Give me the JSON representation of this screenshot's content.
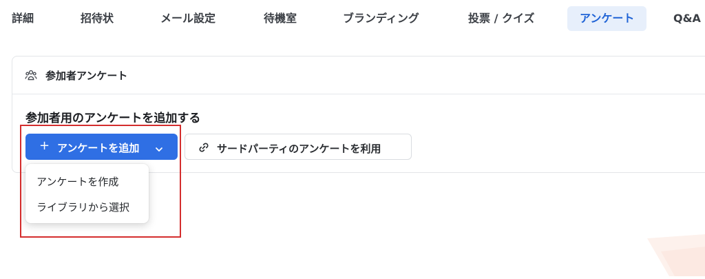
{
  "tabs": [
    {
      "label": "詳細"
    },
    {
      "label": "招待状"
    },
    {
      "label": "メール設定"
    },
    {
      "label": "待機室"
    },
    {
      "label": "ブランディング"
    },
    {
      "label": "投票 / クイズ"
    },
    {
      "label": "アンケート",
      "active": true
    },
    {
      "label": "Q&A"
    }
  ],
  "card": {
    "title": "参加者アンケート",
    "icon": "people-icon"
  },
  "section": {
    "title": "参加者用のアンケートを追加する"
  },
  "buttons": {
    "add_survey": {
      "icon": "plus",
      "label": "アンケートを追加",
      "chevron": "chevron-down-icon"
    },
    "third_party": {
      "icon": "link-icon",
      "label": "サードパーティのアンケートを利用"
    }
  },
  "dropdown": {
    "items": [
      "アンケートを作成",
      "ライブラリから選択"
    ]
  },
  "colors": {
    "primary": "#2f6fe4",
    "active_tab_bg": "#e7effb",
    "active_tab_text": "#1f63d6",
    "highlight": "#d42d2d"
  }
}
